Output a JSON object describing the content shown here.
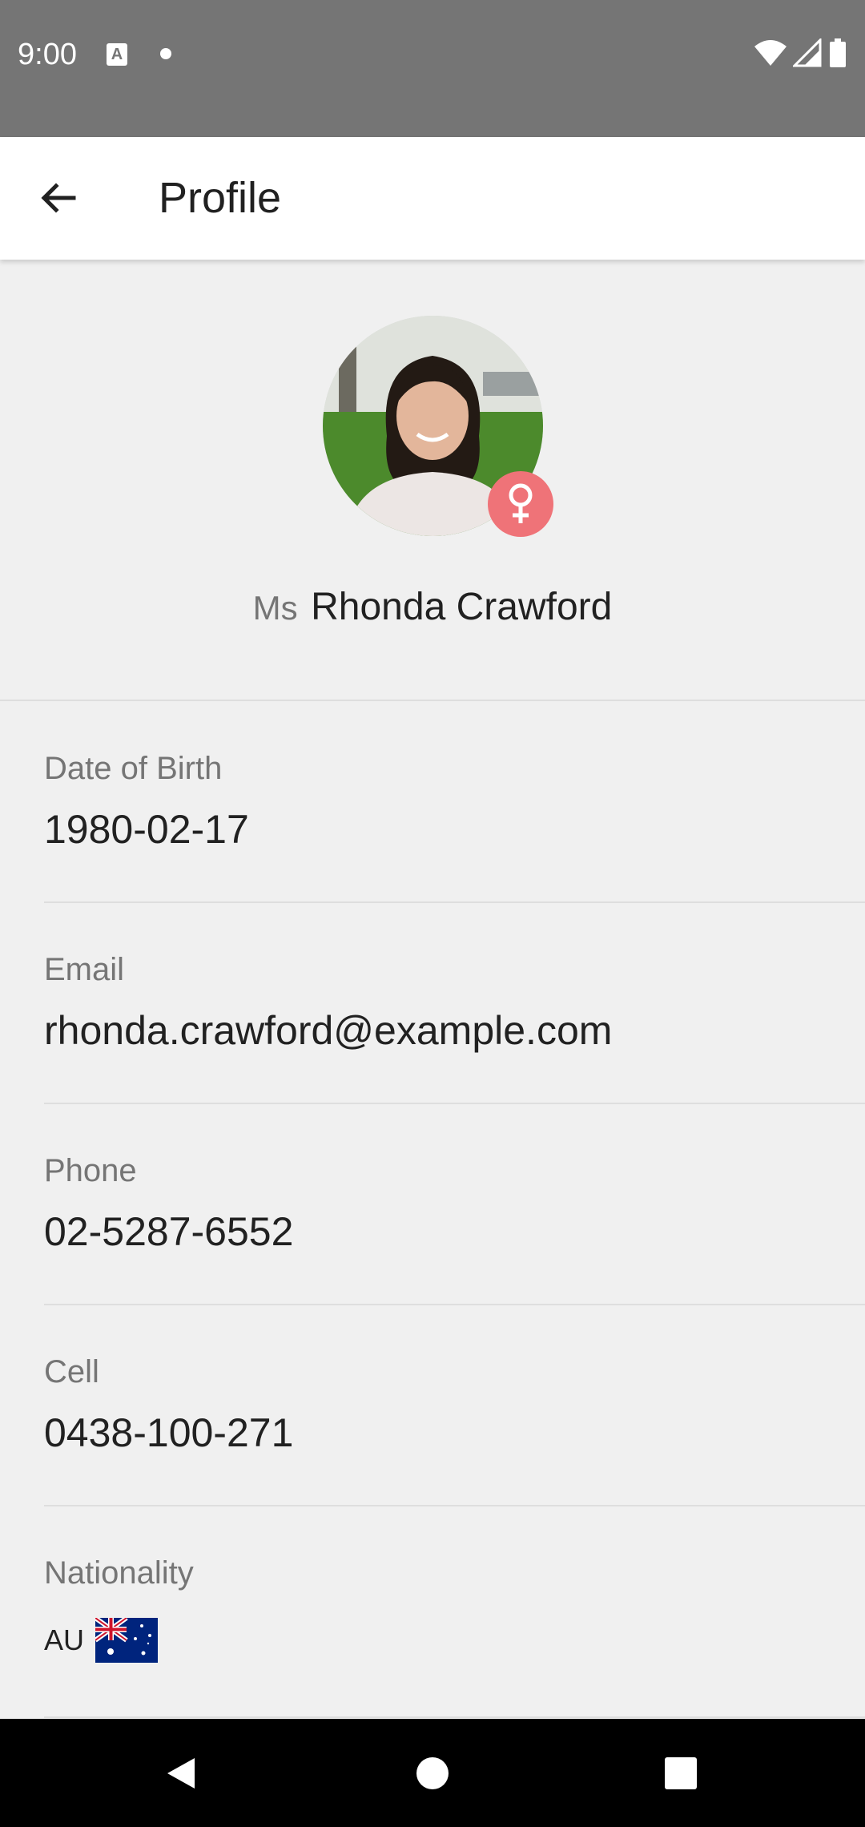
{
  "status_bar": {
    "time": "9:00",
    "icons": [
      "a-notification-icon",
      "dot-icon",
      "wifi-icon",
      "signal-icon",
      "battery-icon"
    ]
  },
  "app_bar": {
    "back_icon": "arrow-left-icon",
    "title": "Profile"
  },
  "profile": {
    "title": "Ms",
    "name": "Rhonda Crawford",
    "gender_icon": "female-icon",
    "gender_badge_color": "#ef7378"
  },
  "fields": [
    {
      "label": "Date of Birth",
      "value": "1980-02-17"
    },
    {
      "label": "Email",
      "value": "rhonda.crawford@example.com"
    },
    {
      "label": "Phone",
      "value": "02-5287-6552"
    },
    {
      "label": "Cell",
      "value": "0438-100-271"
    }
  ],
  "nationality": {
    "label": "Nationality",
    "code": "AU",
    "flag_icon": "australia-flag-icon"
  },
  "nav_bar": {
    "icons": [
      "back-triangle-icon",
      "home-circle-icon",
      "recents-square-icon"
    ]
  }
}
